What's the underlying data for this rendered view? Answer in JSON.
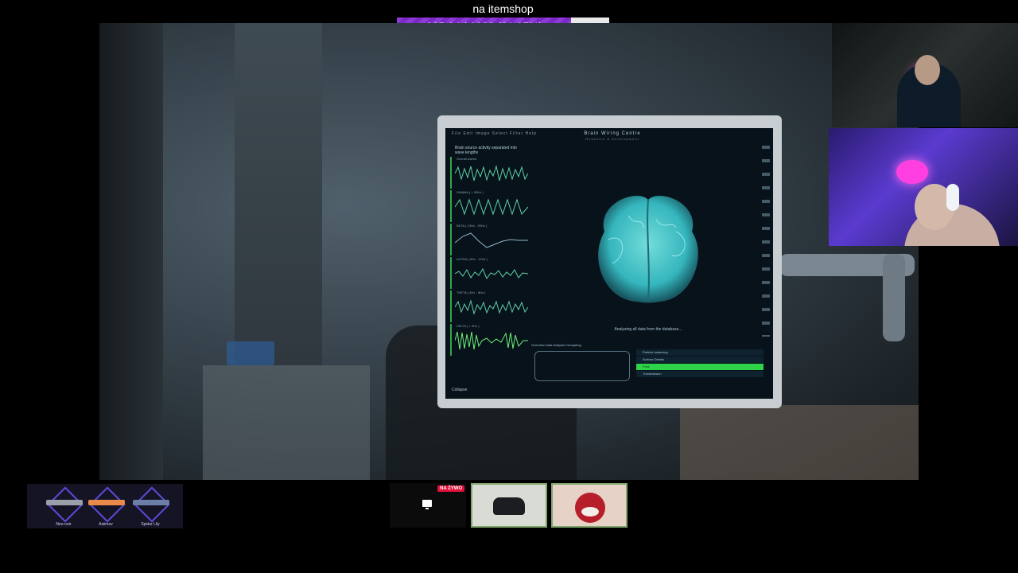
{
  "goal": {
    "title": "na itemshop",
    "progress_text": "835.94 / 1020 (81.95%)",
    "progress_fraction": 0.8195,
    "fill_color": "#8d3ad6"
  },
  "stream_screen": {
    "menu": "File  Edit  Image  Select  Filter  Help",
    "app_title": "Brain Wiring Centre",
    "app_subtitle": "Research & Development",
    "panel_title": "Brain source activity separated into wave lengths",
    "waves": [
      {
        "label": "Overall waves"
      },
      {
        "label": "GAMMA ( > 30Hz )"
      },
      {
        "label": "BETA ( 13Hz - 30Hz )"
      },
      {
        "label": "ALPHA ( 8Hz - 12Hz )"
      },
      {
        "label": "THETA ( 4Hz - 8Hz )"
      },
      {
        "label": "DELTA ( < 4Hz )"
      }
    ],
    "status": "Analyzing all data from the database...",
    "tabs": "Overview   Data   Analysis   Comparing",
    "list_items": [
      "Particle balancing",
      "Surface Details",
      "Frizz",
      "Transmission"
    ],
    "collapse": "Collapse",
    "accent_color": "#2fd34a"
  },
  "skins": [
    {
      "label": "Neo-noir"
    },
    {
      "label": "Asiimov"
    },
    {
      "label": "Spider Lily"
    }
  ],
  "live_badge": "NA ŻYWO"
}
